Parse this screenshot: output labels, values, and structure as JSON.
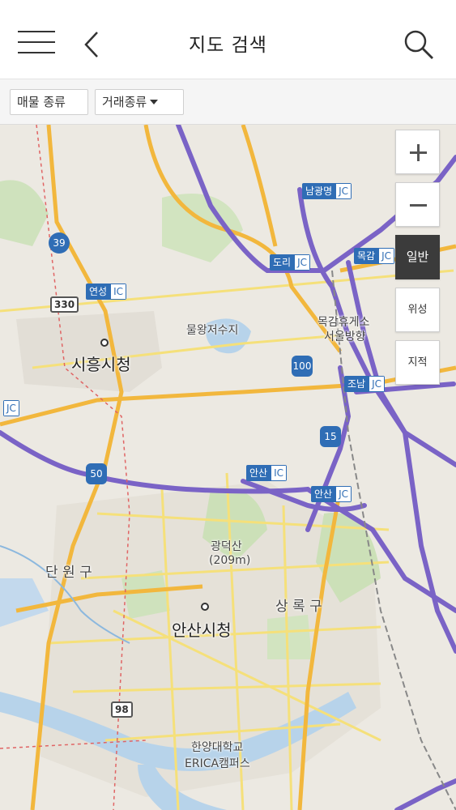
{
  "header": {
    "title": "지도 검색"
  },
  "icons": {
    "menu": "hamburger-menu-icon",
    "back": "chevron-left-icon",
    "search": "search-icon"
  },
  "filters": {
    "property_type": "매물 종류",
    "deal_type": "거래종류"
  },
  "map_controls": {
    "zoom_in": "+",
    "zoom_out": "−",
    "types": [
      "일반",
      "위성",
      "지적"
    ],
    "active_type": "일반"
  },
  "map_labels": {
    "cities": [
      "시흥시청",
      "안산시청"
    ],
    "districts": [
      "단 원 구",
      "상 록 구"
    ],
    "places": [
      "물왕저수지",
      "광덕산",
      "(209m)",
      "목감휴게소",
      "서울방향",
      "한양대학교",
      "ERICA캠퍼스"
    ],
    "interchanges": [
      {
        "name": "남광명",
        "type": "JC"
      },
      {
        "name": "도리",
        "type": "JC"
      },
      {
        "name": "목감",
        "type": "JC"
      },
      {
        "name": "연성",
        "type": "IC"
      },
      {
        "name": "조남",
        "type": "JC"
      },
      {
        "name": "안산",
        "type": "IC"
      },
      {
        "name": "안산",
        "type": "JC"
      },
      {
        "name": "",
        "type": "JC"
      }
    ],
    "route_numbers": [
      "39",
      "330",
      "100",
      "15",
      "50",
      "98"
    ]
  },
  "colors": {
    "expressway": "#7a63c6",
    "arterial": "#f2b73d",
    "local": "#f5e07a",
    "water": "#b7d3ea",
    "park": "#c9dfb4",
    "map_bg": "#ece9e2",
    "accent_blue": "#2f6db5"
  }
}
